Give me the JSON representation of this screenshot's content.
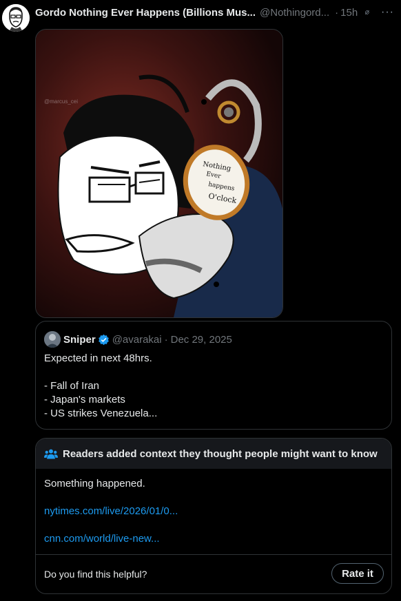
{
  "post": {
    "author_name": "Gordo Nothing Ever Happens (Billions Mus...",
    "handle": "@Nothingord...",
    "separator": "·",
    "time": "15h",
    "more_label": "···"
  },
  "media": {
    "watermark": "@marcus_cei",
    "clock_text": [
      "Nothing",
      "Ever",
      "happens",
      "O'clock"
    ]
  },
  "quote": {
    "name": "Sniper",
    "handle": "@avarakai",
    "separator": "·",
    "date": "Dec 29, 2025",
    "lines": [
      "Expected in next 48hrs.",
      "",
      "- Fall of Iran",
      "- Japan's markets",
      "- US strikes Venezuela..."
    ]
  },
  "community_note": {
    "title": "Readers added context they thought people might want to know",
    "body": "Something happened.",
    "links": [
      "nytimes.com/live/2026/01/0...",
      "cnn.com/world/live-new..."
    ],
    "question": "Do you find this helpful?",
    "rate_label": "Rate it"
  },
  "colors": {
    "background": "#000000",
    "text": "#e7e9ea",
    "muted": "#71767b",
    "link": "#1d9bf0",
    "border": "#2f3336",
    "verified": "#1d9bf0"
  }
}
